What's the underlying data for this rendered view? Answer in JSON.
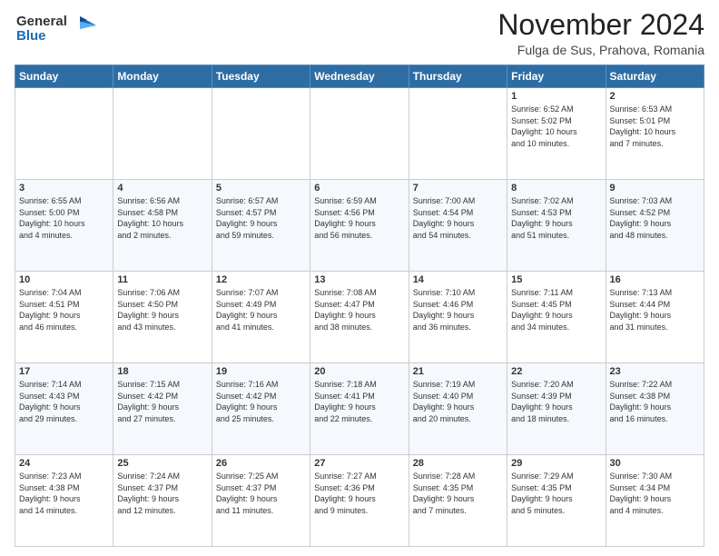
{
  "logo": {
    "line1": "General",
    "line2": "Blue"
  },
  "title": "November 2024",
  "location": "Fulga de Sus, Prahova, Romania",
  "days_of_week": [
    "Sunday",
    "Monday",
    "Tuesday",
    "Wednesday",
    "Thursday",
    "Friday",
    "Saturday"
  ],
  "weeks": [
    [
      {
        "day": "",
        "info": ""
      },
      {
        "day": "",
        "info": ""
      },
      {
        "day": "",
        "info": ""
      },
      {
        "day": "",
        "info": ""
      },
      {
        "day": "",
        "info": ""
      },
      {
        "day": "1",
        "info": "Sunrise: 6:52 AM\nSunset: 5:02 PM\nDaylight: 10 hours\nand 10 minutes."
      },
      {
        "day": "2",
        "info": "Sunrise: 6:53 AM\nSunset: 5:01 PM\nDaylight: 10 hours\nand 7 minutes."
      }
    ],
    [
      {
        "day": "3",
        "info": "Sunrise: 6:55 AM\nSunset: 5:00 PM\nDaylight: 10 hours\nand 4 minutes."
      },
      {
        "day": "4",
        "info": "Sunrise: 6:56 AM\nSunset: 4:58 PM\nDaylight: 10 hours\nand 2 minutes."
      },
      {
        "day": "5",
        "info": "Sunrise: 6:57 AM\nSunset: 4:57 PM\nDaylight: 9 hours\nand 59 minutes."
      },
      {
        "day": "6",
        "info": "Sunrise: 6:59 AM\nSunset: 4:56 PM\nDaylight: 9 hours\nand 56 minutes."
      },
      {
        "day": "7",
        "info": "Sunrise: 7:00 AM\nSunset: 4:54 PM\nDaylight: 9 hours\nand 54 minutes."
      },
      {
        "day": "8",
        "info": "Sunrise: 7:02 AM\nSunset: 4:53 PM\nDaylight: 9 hours\nand 51 minutes."
      },
      {
        "day": "9",
        "info": "Sunrise: 7:03 AM\nSunset: 4:52 PM\nDaylight: 9 hours\nand 48 minutes."
      }
    ],
    [
      {
        "day": "10",
        "info": "Sunrise: 7:04 AM\nSunset: 4:51 PM\nDaylight: 9 hours\nand 46 minutes."
      },
      {
        "day": "11",
        "info": "Sunrise: 7:06 AM\nSunset: 4:50 PM\nDaylight: 9 hours\nand 43 minutes."
      },
      {
        "day": "12",
        "info": "Sunrise: 7:07 AM\nSunset: 4:49 PM\nDaylight: 9 hours\nand 41 minutes."
      },
      {
        "day": "13",
        "info": "Sunrise: 7:08 AM\nSunset: 4:47 PM\nDaylight: 9 hours\nand 38 minutes."
      },
      {
        "day": "14",
        "info": "Sunrise: 7:10 AM\nSunset: 4:46 PM\nDaylight: 9 hours\nand 36 minutes."
      },
      {
        "day": "15",
        "info": "Sunrise: 7:11 AM\nSunset: 4:45 PM\nDaylight: 9 hours\nand 34 minutes."
      },
      {
        "day": "16",
        "info": "Sunrise: 7:13 AM\nSunset: 4:44 PM\nDaylight: 9 hours\nand 31 minutes."
      }
    ],
    [
      {
        "day": "17",
        "info": "Sunrise: 7:14 AM\nSunset: 4:43 PM\nDaylight: 9 hours\nand 29 minutes."
      },
      {
        "day": "18",
        "info": "Sunrise: 7:15 AM\nSunset: 4:42 PM\nDaylight: 9 hours\nand 27 minutes."
      },
      {
        "day": "19",
        "info": "Sunrise: 7:16 AM\nSunset: 4:42 PM\nDaylight: 9 hours\nand 25 minutes."
      },
      {
        "day": "20",
        "info": "Sunrise: 7:18 AM\nSunset: 4:41 PM\nDaylight: 9 hours\nand 22 minutes."
      },
      {
        "day": "21",
        "info": "Sunrise: 7:19 AM\nSunset: 4:40 PM\nDaylight: 9 hours\nand 20 minutes."
      },
      {
        "day": "22",
        "info": "Sunrise: 7:20 AM\nSunset: 4:39 PM\nDaylight: 9 hours\nand 18 minutes."
      },
      {
        "day": "23",
        "info": "Sunrise: 7:22 AM\nSunset: 4:38 PM\nDaylight: 9 hours\nand 16 minutes."
      }
    ],
    [
      {
        "day": "24",
        "info": "Sunrise: 7:23 AM\nSunset: 4:38 PM\nDaylight: 9 hours\nand 14 minutes."
      },
      {
        "day": "25",
        "info": "Sunrise: 7:24 AM\nSunset: 4:37 PM\nDaylight: 9 hours\nand 12 minutes."
      },
      {
        "day": "26",
        "info": "Sunrise: 7:25 AM\nSunset: 4:37 PM\nDaylight: 9 hours\nand 11 minutes."
      },
      {
        "day": "27",
        "info": "Sunrise: 7:27 AM\nSunset: 4:36 PM\nDaylight: 9 hours\nand 9 minutes."
      },
      {
        "day": "28",
        "info": "Sunrise: 7:28 AM\nSunset: 4:35 PM\nDaylight: 9 hours\nand 7 minutes."
      },
      {
        "day": "29",
        "info": "Sunrise: 7:29 AM\nSunset: 4:35 PM\nDaylight: 9 hours\nand 5 minutes."
      },
      {
        "day": "30",
        "info": "Sunrise: 7:30 AM\nSunset: 4:34 PM\nDaylight: 9 hours\nand 4 minutes."
      }
    ]
  ]
}
